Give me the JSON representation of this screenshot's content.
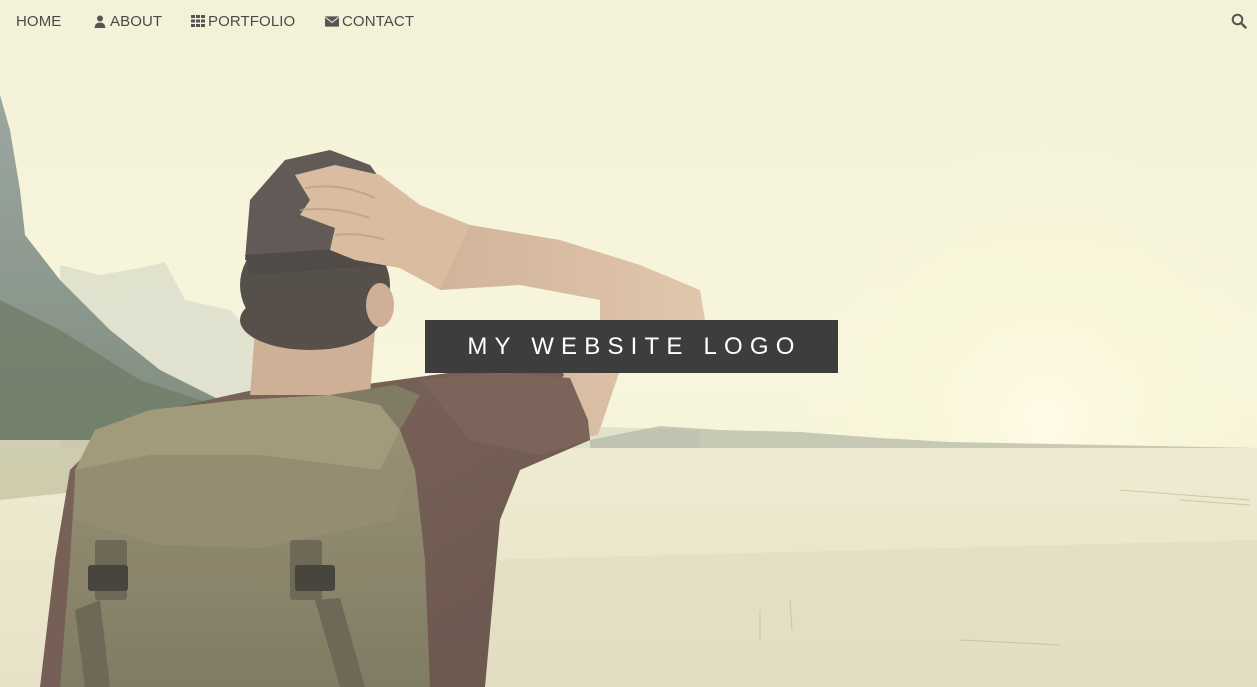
{
  "nav": {
    "items": [
      {
        "label": "HOME",
        "icon": ""
      },
      {
        "label": "ABOUT",
        "icon": "user-icon"
      },
      {
        "label": "PORTFOLIO",
        "icon": "grid-icon"
      },
      {
        "label": "CONTACT",
        "icon": "envelope-icon"
      }
    ],
    "search_icon": "search-icon"
  },
  "hero": {
    "logo_text": "MY WEBSITE LOGO",
    "colors": {
      "sky": "#f8f7dc",
      "logo_background": "#3d3d3d",
      "nav_text": "#4a4a4a"
    }
  }
}
